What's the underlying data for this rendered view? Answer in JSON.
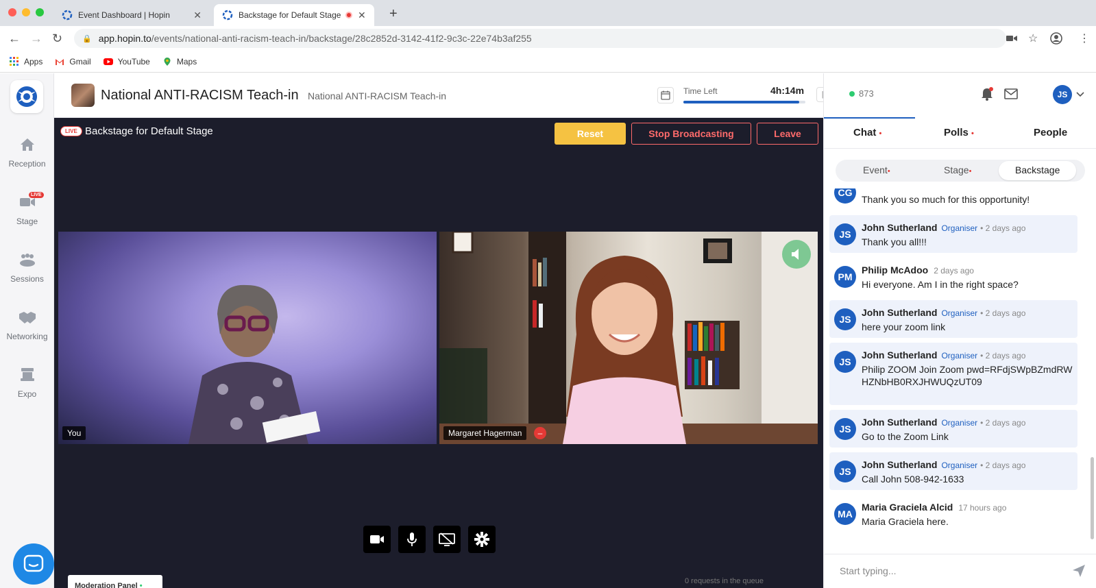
{
  "browser": {
    "tabs": [
      {
        "label": "Event Dashboard | Hopin",
        "close": "✕"
      },
      {
        "label": "Backstage for Default Stage",
        "close": "✕"
      }
    ],
    "new_tab": "+",
    "url_host": "app.hopin.to",
    "url_path": "/events/national-anti-racism-teach-in/backstage/28c2852d-3142-41f2-9c3c-22e74b3af255",
    "bookmarks": [
      {
        "label": "Apps",
        "icon": "apps-grid-icon"
      },
      {
        "label": "Gmail",
        "icon": "gmail-icon"
      },
      {
        "label": "YouTube",
        "icon": "youtube-icon"
      },
      {
        "label": "Maps",
        "icon": "maps-icon"
      }
    ]
  },
  "sidebar": {
    "items": [
      {
        "label": "Reception",
        "icon": "home-icon"
      },
      {
        "label": "Stage",
        "icon": "stage-camera-icon",
        "badge": "LIVE"
      },
      {
        "label": "Sessions",
        "icon": "sessions-group-icon"
      },
      {
        "label": "Networking",
        "icon": "networking-handshake-icon"
      },
      {
        "label": "Expo",
        "icon": "expo-booth-icon"
      }
    ]
  },
  "event": {
    "title": "National ANTI-RACISM Teach-in",
    "subtitle": "National ANTI-RACISM Teach-in",
    "time_left_label": "Time Left",
    "time_left_value": "4h:14m",
    "time_left_fraction": 0.95
  },
  "stage": {
    "live_badge": "LIVE",
    "title": "Backstage for Default Stage",
    "reset_label": "Reset",
    "stop_label": "Stop Broadcasting",
    "leave_label": "Leave",
    "videos": [
      {
        "name": "You"
      },
      {
        "name": "Margaret Hagerman",
        "muted_icon": "–"
      }
    ],
    "controls": [
      "camera-icon",
      "microphone-icon",
      "screen-share-off-icon",
      "settings-gear-icon"
    ],
    "moderation_panel": "Moderation Panel",
    "queue_text": "0 requests in the queue"
  },
  "panel": {
    "online_count": "873",
    "user_initials": "JS",
    "tabs": [
      {
        "label": "Chat",
        "dot": "•"
      },
      {
        "label": "Polls",
        "dot": "•"
      },
      {
        "label": "People",
        "dot": ""
      }
    ],
    "subtabs": [
      {
        "label": "Event",
        "dot": "•"
      },
      {
        "label": "Stage",
        "dot": "•"
      },
      {
        "label": "Backstage",
        "dot": ""
      }
    ],
    "messages": [
      {
        "initials": "CG",
        "name": "",
        "role": "",
        "time": "",
        "text": "Thank you so much for this opportunity!",
        "highlight": false
      },
      {
        "initials": "JS",
        "name": "John Sutherland",
        "role": "Organiser",
        "time": "• 2 days ago",
        "text": "Thank you all!!!",
        "highlight": true
      },
      {
        "initials": "PM",
        "name": "Philip McAdoo",
        "role": "",
        "time": "2 days ago",
        "text": "Hi everyone. Am I in the right space?",
        "highlight": false
      },
      {
        "initials": "JS",
        "name": "John Sutherland",
        "role": "Organiser",
        "time": "• 2 days ago",
        "text": "here your zoom link",
        "highlight": true
      },
      {
        "initials": "JS",
        "name": "John Sutherland",
        "role": "Organiser",
        "time": "• 2 days ago",
        "text": "Philip ZOOM Join Zoom pwd=RFdjSWpBZmdRWHZNbHB0RXJHWUQzUT09",
        "highlight": true
      },
      {
        "initials": "JS",
        "name": "John Sutherland",
        "role": "Organiser",
        "time": "• 2 days ago",
        "text": "Go to the Zoom Link",
        "highlight": true
      },
      {
        "initials": "JS",
        "name": "John Sutherland",
        "role": "Organiser",
        "time": "• 2 days ago",
        "text": "Call John 508-942-1633",
        "highlight": true
      },
      {
        "initials": "MA",
        "name": "Maria Graciela Alcid",
        "role": "",
        "time": "17 hours ago",
        "text": "Maria Graciela here.",
        "highlight": false
      }
    ],
    "input_placeholder": "Start typing..."
  },
  "colors": {
    "accent": "#1e5fbf",
    "live_red": "#e53935",
    "reset_yellow": "#f5c242",
    "stage_bg": "#1c1d2b"
  }
}
